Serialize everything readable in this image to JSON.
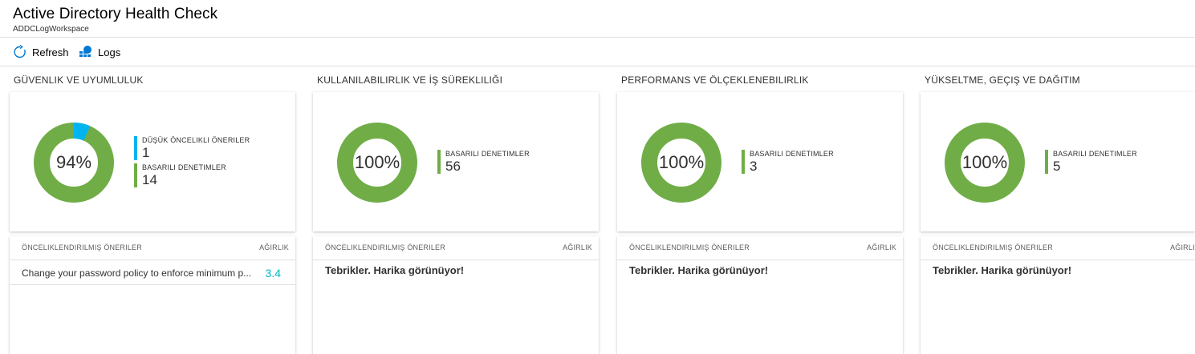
{
  "header": {
    "title": "Active Directory Health Check",
    "subtitle": "ADDCLogWorkspace"
  },
  "toolbar": {
    "refresh_label": "Refresh",
    "logs_label": "Logs"
  },
  "colors": {
    "success": "#70ad47",
    "low_priority": "#00b4f0",
    "weight_value": "#00b7c3"
  },
  "sections": [
    {
      "title": "GÜVENLIK VE UYUMLULUK",
      "percent_label": "94%",
      "success_fraction": 0.9333,
      "legend": [
        {
          "label": "DÜŞÜK ÖNCELIKLI ÖNERILER",
          "value": "1",
          "color": "#00b4f0"
        },
        {
          "label": "BASARILI DENETIMLER",
          "value": "14",
          "color": "#70ad47"
        }
      ],
      "list_header_left": "ÖNCELIKLENDIRILMIŞ ÖNERILER",
      "list_header_right": "AĞIRLIK",
      "rows": [
        {
          "text": "Change your password policy to enforce minimum p...",
          "value": "3.4"
        }
      ]
    },
    {
      "title": "KULLANILABILIRLIK VE İŞ SÜREKLILIĞI",
      "percent_label": "100%",
      "success_fraction": 1,
      "legend": [
        {
          "label": "BASARILI DENETIMLER",
          "value": "56",
          "color": "#70ad47"
        }
      ],
      "list_header_left": "ÖNCELIKLENDIRILMIŞ ÖNERILER",
      "list_header_right": "AĞIRLIK",
      "message": "Tebrikler. Harika görünüyor!"
    },
    {
      "title": "PERFORMANS VE ÖLÇEKLENEBILIRLIK",
      "percent_label": "100%",
      "success_fraction": 1,
      "legend": [
        {
          "label": "BASARILI DENETIMLER",
          "value": "3",
          "color": "#70ad47"
        }
      ],
      "list_header_left": "ÖNCELIKLENDIRILMIŞ ÖNERILER",
      "list_header_right": "AĞIRLIK",
      "message": "Tebrikler. Harika görünüyor!"
    },
    {
      "title": "YÜKSELTME, GEÇIŞ VE DAĞITIM",
      "percent_label": "100%",
      "success_fraction": 1,
      "legend": [
        {
          "label": "BASARILI DENETIMLER",
          "value": "5",
          "color": "#70ad47"
        }
      ],
      "list_header_left": "ÖNCELIKLENDIRILMIŞ ÖNERILER",
      "list_header_right": "AĞIRLIK",
      "message": "Tebrikler. Harika görünüyor!"
    }
  ]
}
